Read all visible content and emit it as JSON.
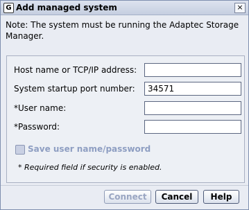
{
  "dialog": {
    "title": "Add managed system",
    "app_icon_glyph": "G",
    "close_glyph": "×",
    "note": "Note: The system must be running the Adaptec Storage Manager."
  },
  "form": {
    "host_label": "Host name or TCP/IP address:",
    "host_value": "",
    "port_label": "System startup port number:",
    "port_value": "34571",
    "user_label": "*User name:",
    "user_value": "",
    "password_label": "*Password:",
    "password_value": "",
    "save_label": "Save user name/password",
    "save_checked": false,
    "required_note": "* Required field if security is enabled."
  },
  "buttons": {
    "connect": "Connect",
    "cancel": "Cancel",
    "help": "Help"
  }
}
